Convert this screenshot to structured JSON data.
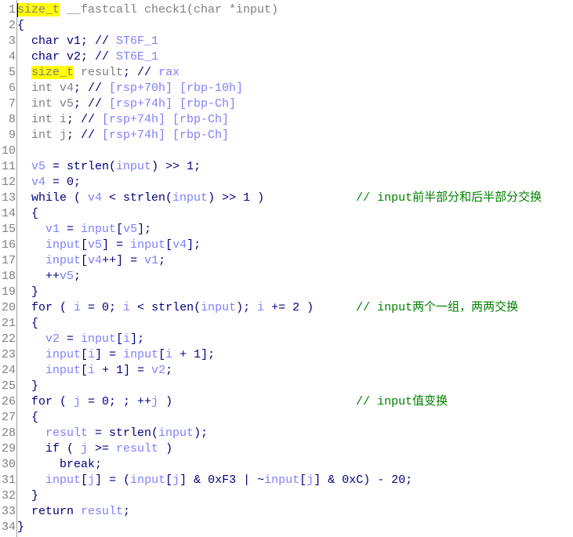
{
  "colors": {
    "keyword": "#000080",
    "variable": "#7f7fff",
    "declaration": "#808080",
    "comment": "#008000",
    "highlight": "#ffff00"
  },
  "lines": [
    [
      [
        "hl",
        "size_t"
      ],
      [
        "g",
        " __fastcall check1(char *input)"
      ]
    ],
    [
      [
        "n",
        "{"
      ]
    ],
    [
      [
        "n",
        "  char v1; // "
      ],
      [
        "v",
        "ST6F_1"
      ]
    ],
    [
      [
        "n",
        "  char v2; // "
      ],
      [
        "v",
        "ST6E_1"
      ]
    ],
    [
      [
        "n",
        "  "
      ],
      [
        "hl",
        "size_t"
      ],
      [
        "g",
        " result"
      ],
      [
        "n",
        "; // "
      ],
      [
        "v",
        "rax"
      ]
    ],
    [
      [
        "g",
        "  int v4"
      ],
      [
        "n",
        "; // "
      ],
      [
        "v",
        "[rsp+70h] [rbp-10h]"
      ]
    ],
    [
      [
        "g",
        "  int v5"
      ],
      [
        "n",
        "; // "
      ],
      [
        "v",
        "[rsp+74h] [rbp-Ch]"
      ]
    ],
    [
      [
        "g",
        "  int i"
      ],
      [
        "n",
        "; // "
      ],
      [
        "v",
        "[rsp+74h] [rbp-Ch]"
      ]
    ],
    [
      [
        "g",
        "  int j"
      ],
      [
        "n",
        "; // "
      ],
      [
        "v",
        "[rsp+74h] [rbp-Ch]"
      ]
    ],
    [],
    [
      [
        "n",
        "  "
      ],
      [
        "v",
        "v5"
      ],
      [
        "n",
        " = strlen("
      ],
      [
        "v",
        "input"
      ],
      [
        "n",
        ") >> 1;"
      ]
    ],
    [
      [
        "n",
        "  "
      ],
      [
        "v",
        "v4"
      ],
      [
        "n",
        " = 0;"
      ]
    ],
    [
      [
        "n",
        "  while ( "
      ],
      [
        "v",
        "v4"
      ],
      [
        "n",
        " < strlen("
      ],
      [
        "v",
        "input"
      ],
      [
        "n",
        ") >> 1 )             "
      ],
      [
        "c",
        "// input前半部分和后半部分交换"
      ]
    ],
    [
      [
        "n",
        "  {"
      ]
    ],
    [
      [
        "n",
        "    "
      ],
      [
        "v",
        "v1"
      ],
      [
        "n",
        " = "
      ],
      [
        "v",
        "input"
      ],
      [
        "n",
        "["
      ],
      [
        "v",
        "v5"
      ],
      [
        "n",
        "];"
      ]
    ],
    [
      [
        "n",
        "    "
      ],
      [
        "v",
        "input"
      ],
      [
        "n",
        "["
      ],
      [
        "v",
        "v5"
      ],
      [
        "n",
        "] = "
      ],
      [
        "v",
        "input"
      ],
      [
        "n",
        "["
      ],
      [
        "v",
        "v4"
      ],
      [
        "n",
        "];"
      ]
    ],
    [
      [
        "n",
        "    "
      ],
      [
        "v",
        "input"
      ],
      [
        "n",
        "["
      ],
      [
        "v",
        "v4"
      ],
      [
        "n",
        "++] = "
      ],
      [
        "v",
        "v1"
      ],
      [
        "n",
        ";"
      ]
    ],
    [
      [
        "n",
        "    ++"
      ],
      [
        "v",
        "v5"
      ],
      [
        "n",
        ";"
      ]
    ],
    [
      [
        "n",
        "  }"
      ]
    ],
    [
      [
        "n",
        "  for ( "
      ],
      [
        "v",
        "i"
      ],
      [
        "n",
        " = 0; "
      ],
      [
        "v",
        "i"
      ],
      [
        "n",
        " < strlen("
      ],
      [
        "v",
        "input"
      ],
      [
        "n",
        "); "
      ],
      [
        "v",
        "i"
      ],
      [
        "n",
        " += 2 )      "
      ],
      [
        "c",
        "// input两个一组，两两交换"
      ]
    ],
    [
      [
        "n",
        "  {"
      ]
    ],
    [
      [
        "n",
        "    "
      ],
      [
        "v",
        "v2"
      ],
      [
        "n",
        " = "
      ],
      [
        "v",
        "input"
      ],
      [
        "n",
        "["
      ],
      [
        "v",
        "i"
      ],
      [
        "n",
        "];"
      ]
    ],
    [
      [
        "n",
        "    "
      ],
      [
        "v",
        "input"
      ],
      [
        "n",
        "["
      ],
      [
        "v",
        "i"
      ],
      [
        "n",
        "] = "
      ],
      [
        "v",
        "input"
      ],
      [
        "n",
        "["
      ],
      [
        "v",
        "i"
      ],
      [
        "n",
        " + 1];"
      ]
    ],
    [
      [
        "n",
        "    "
      ],
      [
        "v",
        "input"
      ],
      [
        "n",
        "["
      ],
      [
        "v",
        "i"
      ],
      [
        "n",
        " + 1] = "
      ],
      [
        "v",
        "v2"
      ],
      [
        "n",
        ";"
      ]
    ],
    [
      [
        "n",
        "  }"
      ]
    ],
    [
      [
        "n",
        "  for ( "
      ],
      [
        "v",
        "j"
      ],
      [
        "n",
        " = 0; ; ++"
      ],
      [
        "v",
        "j"
      ],
      [
        "n",
        " )                          "
      ],
      [
        "c",
        "// input值变换"
      ]
    ],
    [
      [
        "n",
        "  {"
      ]
    ],
    [
      [
        "n",
        "    "
      ],
      [
        "v",
        "result"
      ],
      [
        "n",
        " = strlen("
      ],
      [
        "v",
        "input"
      ],
      [
        "n",
        ");"
      ]
    ],
    [
      [
        "n",
        "    if ( "
      ],
      [
        "v",
        "j"
      ],
      [
        "n",
        " >= "
      ],
      [
        "v",
        "result"
      ],
      [
        "n",
        " )"
      ]
    ],
    [
      [
        "n",
        "      break;"
      ]
    ],
    [
      [
        "n",
        "    "
      ],
      [
        "v",
        "input"
      ],
      [
        "n",
        "["
      ],
      [
        "v",
        "j"
      ],
      [
        "n",
        "] = ("
      ],
      [
        "v",
        "input"
      ],
      [
        "n",
        "["
      ],
      [
        "v",
        "j"
      ],
      [
        "n",
        "] & 0xF3 | ~"
      ],
      [
        "v",
        "input"
      ],
      [
        "n",
        "["
      ],
      [
        "v",
        "j"
      ],
      [
        "n",
        "] & 0xC) - 20;"
      ]
    ],
    [
      [
        "n",
        "  }"
      ]
    ],
    [
      [
        "n",
        "  return "
      ],
      [
        "v",
        "result"
      ],
      [
        "n",
        ";"
      ]
    ],
    [
      [
        "n",
        "}"
      ]
    ]
  ]
}
